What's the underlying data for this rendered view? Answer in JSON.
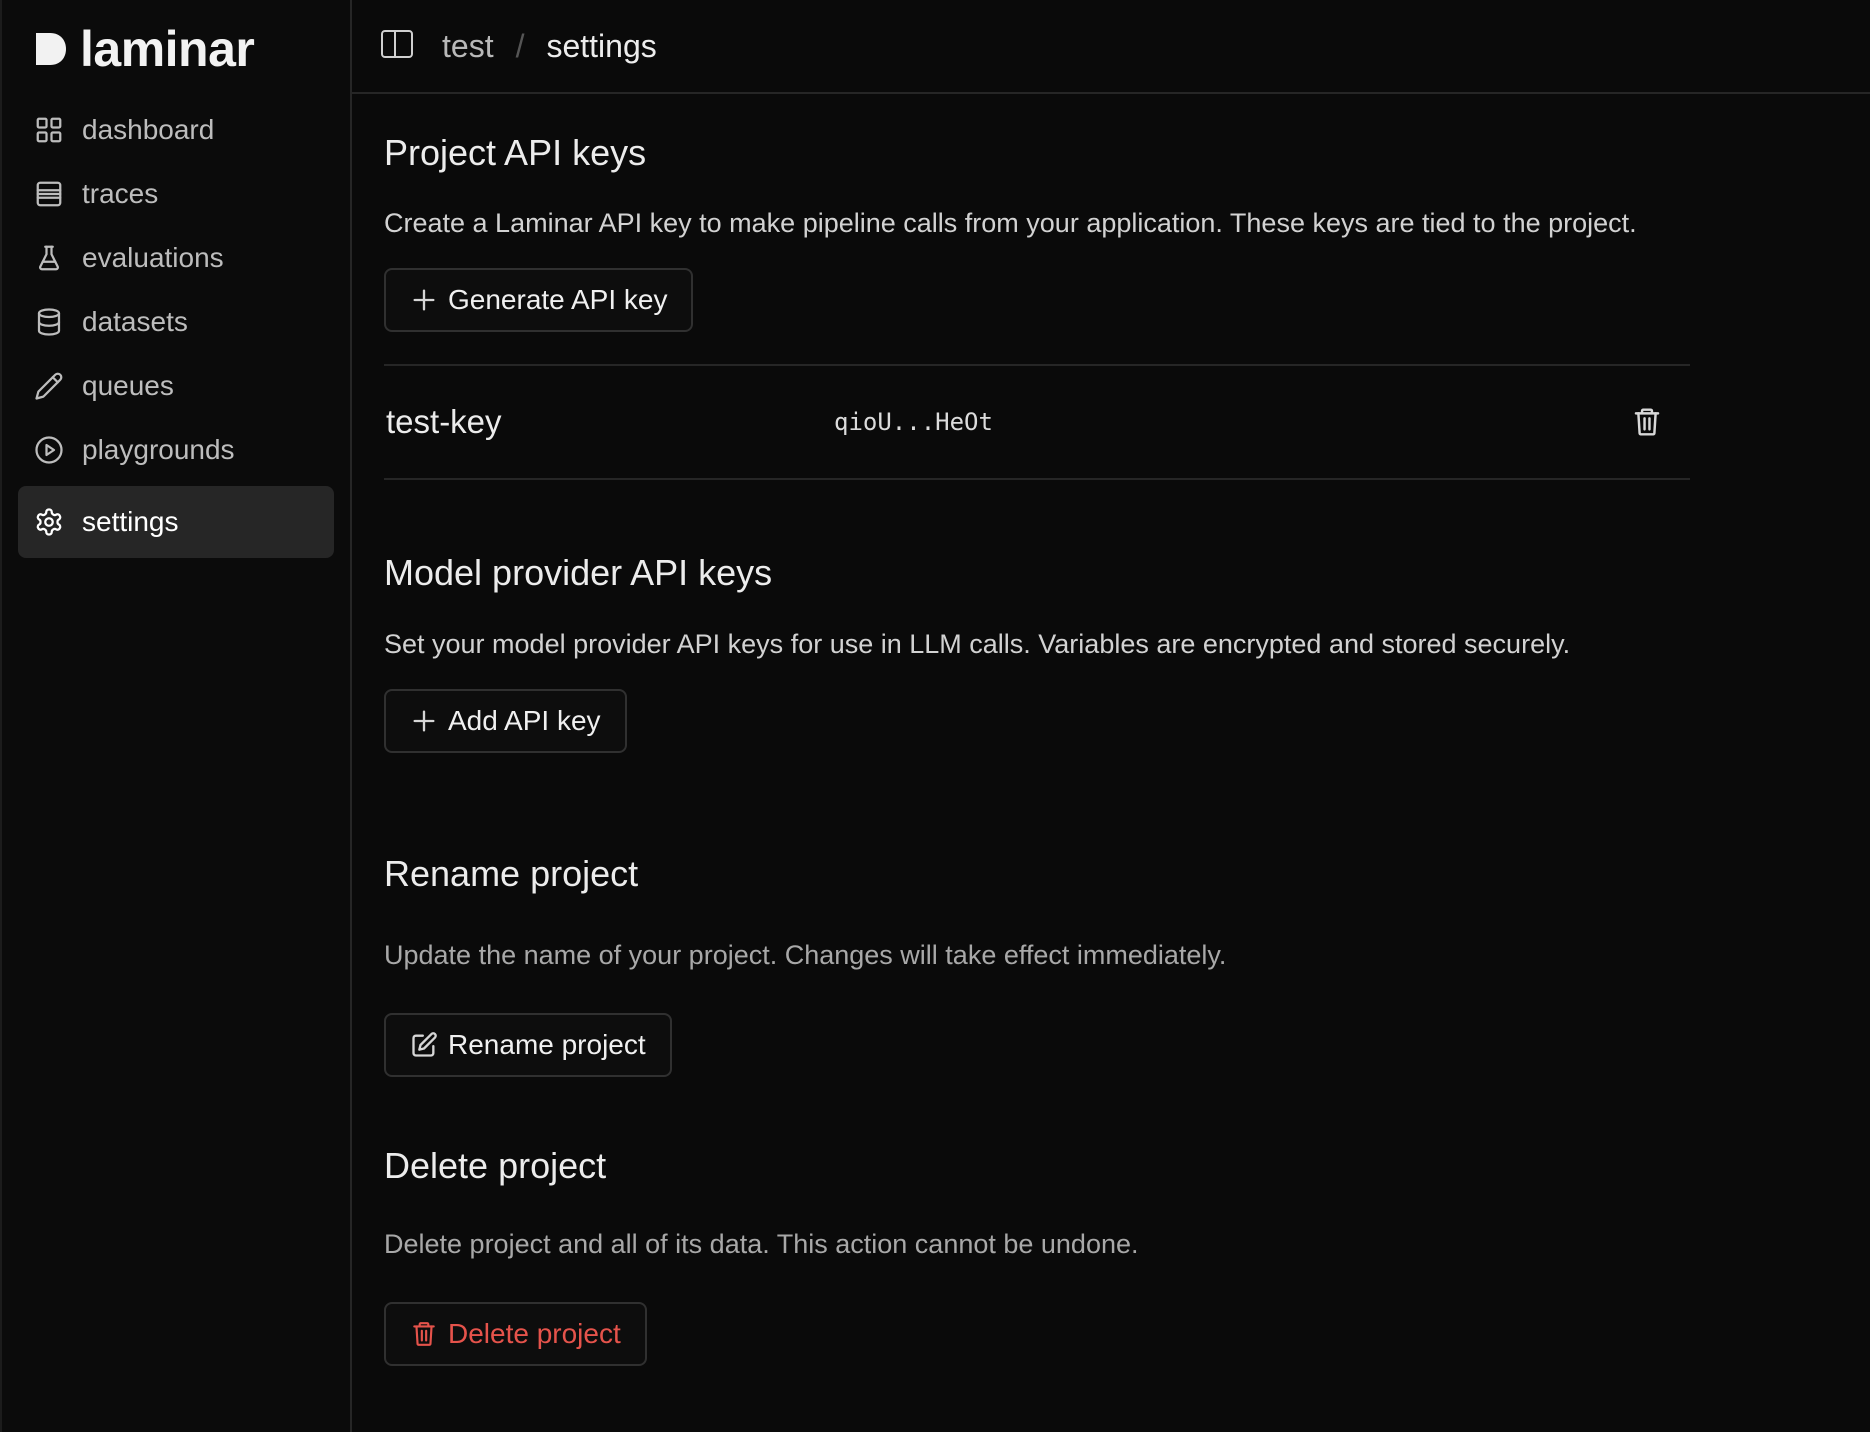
{
  "brand": {
    "name": "laminar"
  },
  "sidebar": {
    "items": [
      {
        "label": "dashboard",
        "icon": "dashboard-grid-icon",
        "active": false
      },
      {
        "label": "traces",
        "icon": "traces-list-icon",
        "active": false
      },
      {
        "label": "evaluations",
        "icon": "flask-icon",
        "active": false
      },
      {
        "label": "datasets",
        "icon": "database-icon",
        "active": false
      },
      {
        "label": "queues",
        "icon": "pencil-icon",
        "active": false
      },
      {
        "label": "playgrounds",
        "icon": "play-circle-icon",
        "active": false
      },
      {
        "label": "settings",
        "icon": "gear-icon",
        "active": true
      }
    ]
  },
  "header": {
    "breadcrumb": {
      "project": "test",
      "separator": "/",
      "current": "settings"
    }
  },
  "project_api_keys": {
    "title": "Project API keys",
    "description": "Create a Laminar API key to make pipeline calls from your application. These keys are tied to the project.",
    "generate_label": "Generate API key",
    "keys": [
      {
        "name": "test-key",
        "value": "qioU...HeOt"
      }
    ]
  },
  "model_provider_keys": {
    "title": "Model provider API keys",
    "description": "Set your model provider API keys for use in LLM calls. Variables are encrypted and stored securely.",
    "add_label": "Add API key"
  },
  "rename_project": {
    "title": "Rename project",
    "description": "Update the name of your project. Changes will take effect immediately.",
    "button_label": "Rename project"
  },
  "delete_project": {
    "title": "Delete project",
    "description": "Delete project and all of its data. This action cannot be undone.",
    "button_label": "Delete project"
  },
  "colors": {
    "background": "#0a0a0a",
    "active_nav": "#262626",
    "danger": "#e5534b",
    "border": "#303030"
  }
}
